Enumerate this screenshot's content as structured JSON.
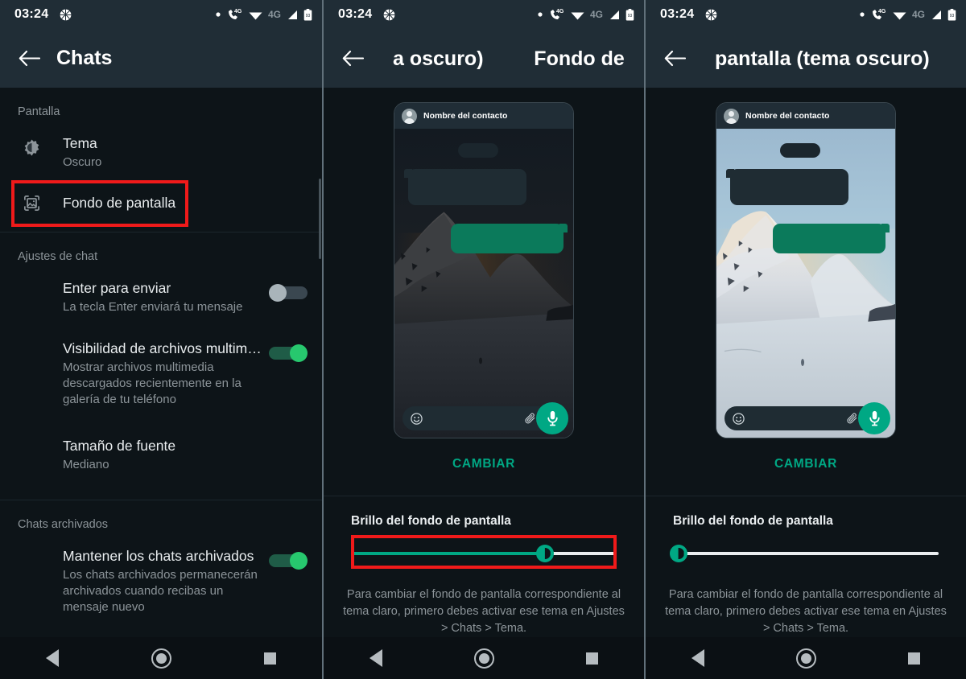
{
  "status_bar": {
    "time": "03:24",
    "icons": [
      "basketball-icon",
      "call-4g-icon",
      "wifi-icon",
      "signal-4g-label",
      "signal-bars-icon",
      "battery-icon"
    ],
    "network_label": "4G",
    "network_small_label": "4G",
    "battery_level": "93"
  },
  "colors": {
    "accent_green": "#00a884",
    "toolbar_bg": "#202d36",
    "content_bg": "#0d1418",
    "highlight_red": "#f01a1a",
    "bubble_out_green": "#0b7a5b"
  },
  "panels": [
    {
      "id": "chats-settings",
      "toolbar": {
        "title": "Chats",
        "back_icon": "arrow-back-icon"
      },
      "sections": [
        {
          "header": "Pantalla",
          "items": [
            {
              "icon": "brightness-theme-icon",
              "title": "Tema",
              "subtitle": "Oscuro",
              "control": "none",
              "highlighted": false
            },
            {
              "icon": "wallpaper-image-icon",
              "title": "Fondo de pantalla",
              "subtitle": "",
              "control": "none",
              "highlighted": true
            }
          ]
        },
        {
          "header": "Ajustes de chat",
          "items": [
            {
              "icon": "",
              "title": "Enter para enviar",
              "subtitle": "La tecla Enter enviará tu mensaje",
              "control": "toggle-off",
              "highlighted": false
            },
            {
              "icon": "",
              "title": "Visibilidad de archivos multim…",
              "subtitle": "Mostrar archivos multimedia descargados recientemente en la galería de tu teléfono",
              "control": "toggle-on",
              "highlighted": false
            },
            {
              "icon": "",
              "title": "Tamaño de fuente",
              "subtitle": "Mediano",
              "control": "none",
              "highlighted": false
            }
          ]
        },
        {
          "header": "Chats archivados",
          "items": [
            {
              "icon": "",
              "title": "Mantener los chats archivados",
              "subtitle": "Los chats archivados permanecerán archivados cuando recibas un mensaje nuevo",
              "control": "toggle-on",
              "highlighted": false
            }
          ]
        }
      ]
    },
    {
      "id": "wallpaper-dark-dim",
      "toolbar": {
        "back_icon": "arrow-back-icon",
        "marquee_left": "a oscuro)",
        "marquee_right": "Fondo de p",
        "full_title": "Fondo de pantalla (tema oscuro)"
      },
      "preview": {
        "contact_name": "Nombre del contacto",
        "wallpaper": "snowy-mountain-dimmed",
        "composer_icons": [
          "emoji-icon",
          "attach-clip-icon",
          "camera-icon"
        ],
        "fab_icon": "microphone-icon"
      },
      "change_button": "CAMBIAR",
      "brightness_label": "Brillo del fondo de pantalla",
      "slider": {
        "value": 73,
        "highlighted": true
      },
      "hint": "Para cambiar el fondo de pantalla correspondiente al tema claro, primero debes activar ese tema en Ajustes > Chats > Tema."
    },
    {
      "id": "wallpaper-dark-bright",
      "toolbar": {
        "back_icon": "arrow-back-icon",
        "marquee_left": "pantalla (tema oscuro)",
        "marquee_right": "",
        "full_title": "Fondo de pantalla (tema oscuro)"
      },
      "preview": {
        "contact_name": "Nombre del contacto",
        "wallpaper": "snowy-mountain-bright",
        "composer_icons": [
          "emoji-icon",
          "attach-clip-icon",
          "camera-icon"
        ],
        "fab_icon": "microphone-icon"
      },
      "change_button": "CAMBIAR",
      "brightness_label": "Brillo del fondo de pantalla",
      "slider": {
        "value": 2,
        "highlighted": false
      },
      "hint": "Para cambiar el fondo de pantalla correspondiente al tema claro, primero debes activar ese tema en Ajustes > Chats > Tema."
    }
  ],
  "nav_bar": {
    "back": "nav-back-icon",
    "home": "nav-home-icon",
    "recents": "nav-recents-icon"
  }
}
